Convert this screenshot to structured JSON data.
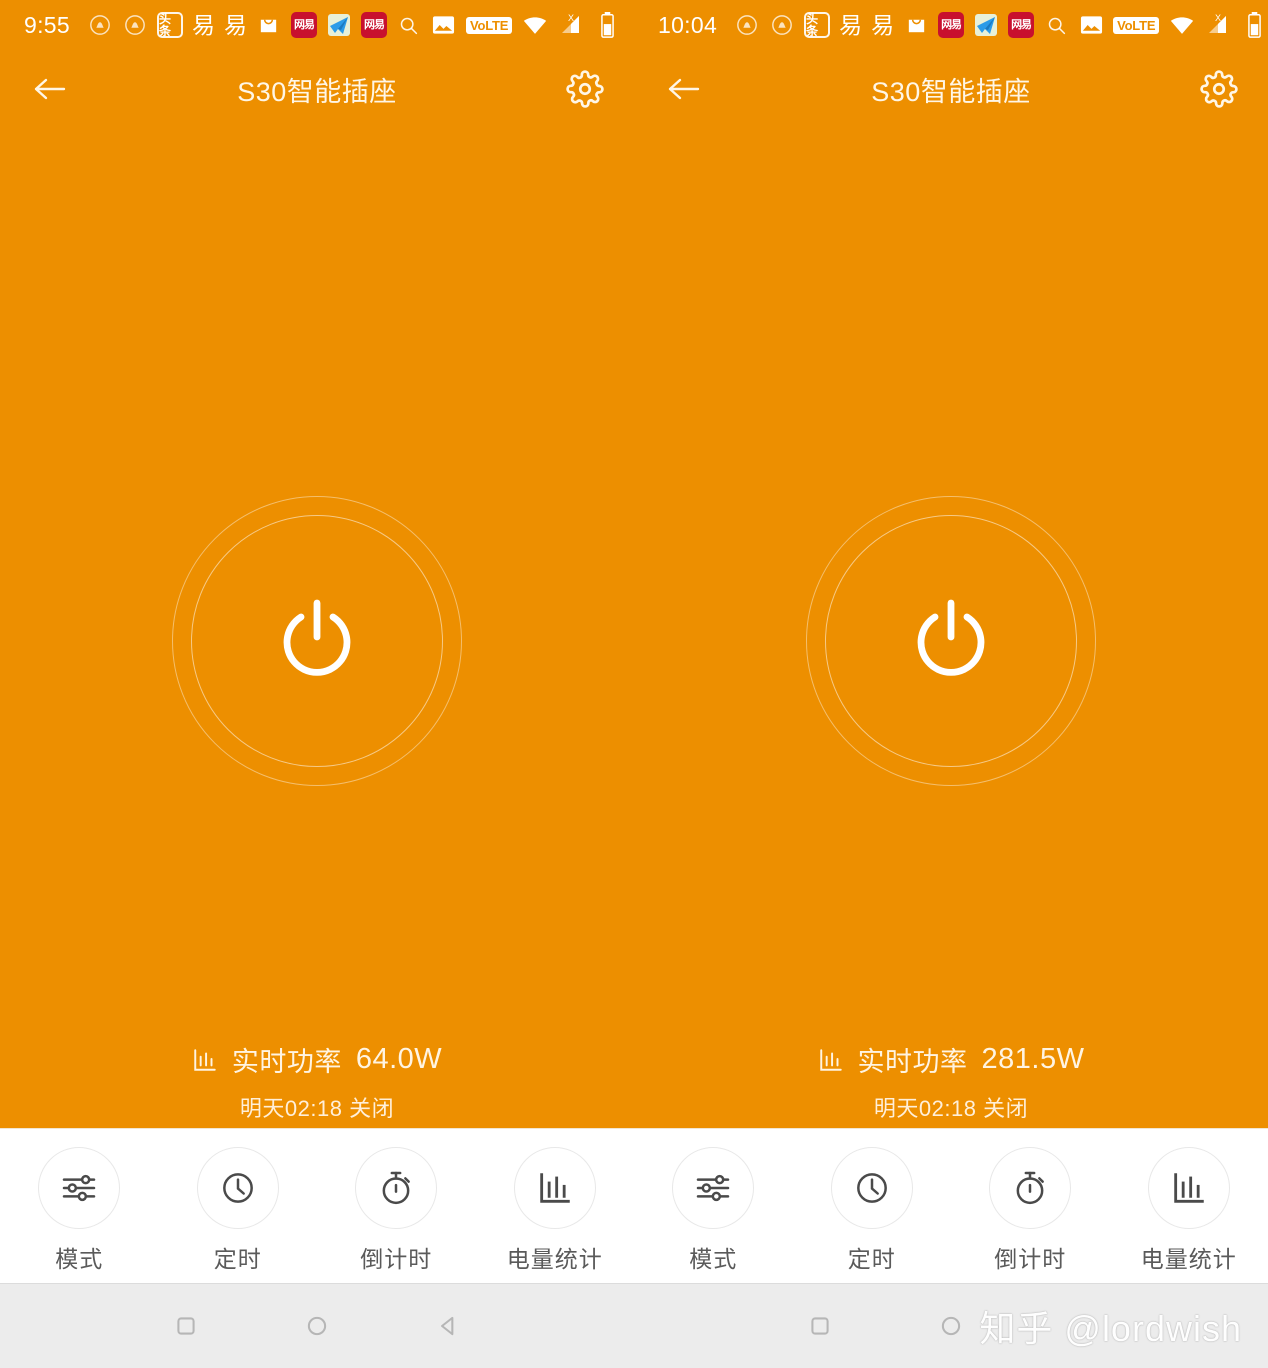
{
  "app": {
    "background_color": "#ED8F00",
    "toolbar_background": "#FFFFFF",
    "navbar_background": "#ECECEC"
  },
  "panes": [
    {
      "statusbar": {
        "time": "9:55",
        "notification_icons": [
          "app-icon",
          "app-icon",
          "toutiao-icon",
          "netease-yi-icon",
          "netease-yi-icon",
          "shopping-bag-icon",
          "netease-news-icon",
          "telegram-icon",
          "netease-news-icon",
          "search-icon",
          "gallery-icon"
        ],
        "toutiao_label": "头条",
        "yi_label": "易",
        "netease_label": "网易",
        "volte_label": "VoLTE",
        "system_icons": [
          "volte-badge",
          "wifi-icon",
          "cellular-signal-icon",
          "battery-icon"
        ],
        "signal_state": "X"
      },
      "titlebar": {
        "back_icon": "back-arrow-icon",
        "title": "S30智能插座",
        "settings_icon": "gear-icon"
      },
      "power": {
        "icon": "power-icon",
        "state": "on"
      },
      "info": {
        "chart_icon": "bar-chart-icon",
        "label": "实时功率",
        "value": "64.0W",
        "schedule": "明天02:18 关闭"
      },
      "toolbar": [
        {
          "icon": "sliders-icon",
          "label": "模式"
        },
        {
          "icon": "clock-icon",
          "label": "定时"
        },
        {
          "icon": "stopwatch-icon",
          "label": "倒计时"
        },
        {
          "icon": "bar-chart-icon",
          "label": "电量统计"
        }
      ],
      "navbar": [
        {
          "icon": "recents-square-icon"
        },
        {
          "icon": "home-circle-icon"
        },
        {
          "icon": "back-triangle-icon"
        }
      ]
    },
    {
      "statusbar": {
        "time": "10:04",
        "notification_icons": [
          "app-icon",
          "app-icon",
          "toutiao-icon",
          "netease-yi-icon",
          "netease-yi-icon",
          "shopping-bag-icon",
          "netease-news-icon",
          "telegram-icon",
          "netease-news-icon",
          "search-icon",
          "gallery-icon"
        ],
        "toutiao_label": "头条",
        "yi_label": "易",
        "netease_label": "网易",
        "volte_label": "VoLTE",
        "system_icons": [
          "volte-badge",
          "wifi-icon",
          "cellular-signal-icon",
          "battery-icon"
        ],
        "signal_state": "X"
      },
      "titlebar": {
        "back_icon": "back-arrow-icon",
        "title": "S30智能插座",
        "settings_icon": "gear-icon"
      },
      "power": {
        "icon": "power-icon",
        "state": "on"
      },
      "info": {
        "chart_icon": "bar-chart-icon",
        "label": "实时功率",
        "value": "281.5W",
        "schedule": "明天02:18 关闭"
      },
      "toolbar": [
        {
          "icon": "sliders-icon",
          "label": "模式"
        },
        {
          "icon": "clock-icon",
          "label": "定时"
        },
        {
          "icon": "stopwatch-icon",
          "label": "倒计时"
        },
        {
          "icon": "bar-chart-icon",
          "label": "电量统计"
        }
      ],
      "navbar": [
        {
          "icon": "recents-square-icon"
        },
        {
          "icon": "home-circle-icon"
        }
      ]
    }
  ],
  "watermark": "知乎 @lordwish"
}
